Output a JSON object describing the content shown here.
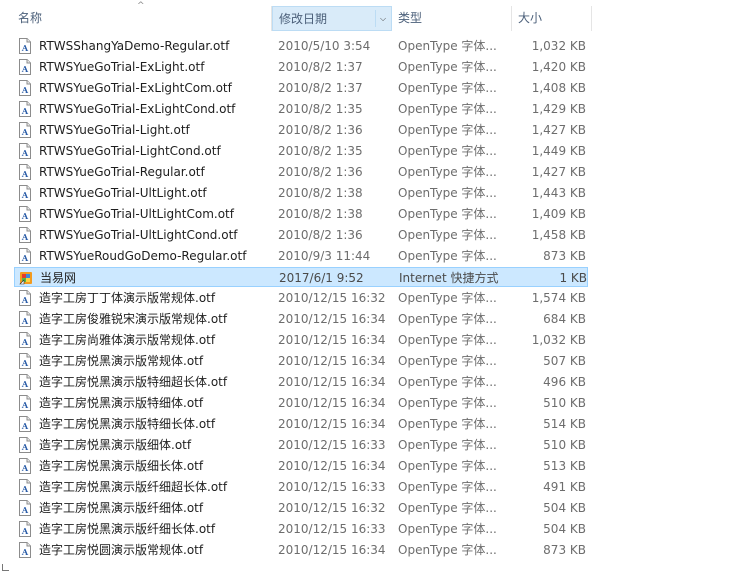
{
  "columns": {
    "name": "名称",
    "date": "修改日期",
    "type": "类型",
    "size": "大小"
  },
  "sort_icon": "sort-up-arrow-icon",
  "selected_index": 11,
  "files": [
    {
      "name": "RTWSShangYaDemo-Regular.otf",
      "date": "2010/5/10 3:54",
      "type": "OpenType 字体...",
      "size": "1,032 KB",
      "icon": "font-file-icon"
    },
    {
      "name": "RTWSYueGoTrial-ExLight.otf",
      "date": "2010/8/2 1:37",
      "type": "OpenType 字体...",
      "size": "1,420 KB",
      "icon": "font-file-icon"
    },
    {
      "name": "RTWSYueGoTrial-ExLightCom.otf",
      "date": "2010/8/2 1:37",
      "type": "OpenType 字体...",
      "size": "1,408 KB",
      "icon": "font-file-icon"
    },
    {
      "name": "RTWSYueGoTrial-ExLightCond.otf",
      "date": "2010/8/2 1:35",
      "type": "OpenType 字体...",
      "size": "1,429 KB",
      "icon": "font-file-icon"
    },
    {
      "name": "RTWSYueGoTrial-Light.otf",
      "date": "2010/8/2 1:36",
      "type": "OpenType 字体...",
      "size": "1,427 KB",
      "icon": "font-file-icon"
    },
    {
      "name": "RTWSYueGoTrial-LightCond.otf",
      "date": "2010/8/2 1:35",
      "type": "OpenType 字体...",
      "size": "1,449 KB",
      "icon": "font-file-icon"
    },
    {
      "name": "RTWSYueGoTrial-Regular.otf",
      "date": "2010/8/2 1:36",
      "type": "OpenType 字体...",
      "size": "1,427 KB",
      "icon": "font-file-icon"
    },
    {
      "name": "RTWSYueGoTrial-UltLight.otf",
      "date": "2010/8/2 1:38",
      "type": "OpenType 字体...",
      "size": "1,443 KB",
      "icon": "font-file-icon"
    },
    {
      "name": "RTWSYueGoTrial-UltLightCom.otf",
      "date": "2010/8/2 1:38",
      "type": "OpenType 字体...",
      "size": "1,409 KB",
      "icon": "font-file-icon"
    },
    {
      "name": "RTWSYueGoTrial-UltLightCond.otf",
      "date": "2010/8/2 1:36",
      "type": "OpenType 字体...",
      "size": "1,458 KB",
      "icon": "font-file-icon"
    },
    {
      "name": "RTWSYueRoudGoDemo-Regular.otf",
      "date": "2010/9/3 11:44",
      "type": "OpenType 字体...",
      "size": "873 KB",
      "icon": "font-file-icon"
    },
    {
      "name": "当易网",
      "date": "2017/6/1 9:52",
      "type": "Internet 快捷方式",
      "size": "1 KB",
      "icon": "internet-shortcut-icon"
    },
    {
      "name": "造字工房丁丁体演示版常规体.otf",
      "date": "2010/12/15 16:32",
      "type": "OpenType 字体...",
      "size": "1,574 KB",
      "icon": "font-file-icon"
    },
    {
      "name": "造字工房俊雅锐宋演示版常规体.otf",
      "date": "2010/12/15 16:34",
      "type": "OpenType 字体...",
      "size": "684 KB",
      "icon": "font-file-icon"
    },
    {
      "name": "造字工房尚雅体演示版常规体.otf",
      "date": "2010/12/15 16:34",
      "type": "OpenType 字体...",
      "size": "1,032 KB",
      "icon": "font-file-icon"
    },
    {
      "name": "造字工房悦黑演示版常规体.otf",
      "date": "2010/12/15 16:34",
      "type": "OpenType 字体...",
      "size": "507 KB",
      "icon": "font-file-icon"
    },
    {
      "name": "造字工房悦黑演示版特细超长体.otf",
      "date": "2010/12/15 16:34",
      "type": "OpenType 字体...",
      "size": "496 KB",
      "icon": "font-file-icon"
    },
    {
      "name": "造字工房悦黑演示版特细体.otf",
      "date": "2010/12/15 16:34",
      "type": "OpenType 字体...",
      "size": "510 KB",
      "icon": "font-file-icon"
    },
    {
      "name": "造字工房悦黑演示版特细长体.otf",
      "date": "2010/12/15 16:34",
      "type": "OpenType 字体...",
      "size": "514 KB",
      "icon": "font-file-icon"
    },
    {
      "name": "造字工房悦黑演示版细体.otf",
      "date": "2010/12/15 16:33",
      "type": "OpenType 字体...",
      "size": "510 KB",
      "icon": "font-file-icon"
    },
    {
      "name": "造字工房悦黑演示版细长体.otf",
      "date": "2010/12/15 16:34",
      "type": "OpenType 字体...",
      "size": "513 KB",
      "icon": "font-file-icon"
    },
    {
      "name": "造字工房悦黑演示版纤细超长体.otf",
      "date": "2010/12/15 16:33",
      "type": "OpenType 字体...",
      "size": "491 KB",
      "icon": "font-file-icon"
    },
    {
      "name": "造字工房悦黑演示版纤细体.otf",
      "date": "2010/12/15 16:32",
      "type": "OpenType 字体...",
      "size": "504 KB",
      "icon": "font-file-icon"
    },
    {
      "name": "造字工房悦黑演示版纤细长体.otf",
      "date": "2010/12/15 16:33",
      "type": "OpenType 字体...",
      "size": "504 KB",
      "icon": "font-file-icon"
    },
    {
      "name": "造字工房悦圆演示版常规体.otf",
      "date": "2010/12/15 16:34",
      "type": "OpenType 字体...",
      "size": "873 KB",
      "icon": "font-file-icon"
    }
  ]
}
